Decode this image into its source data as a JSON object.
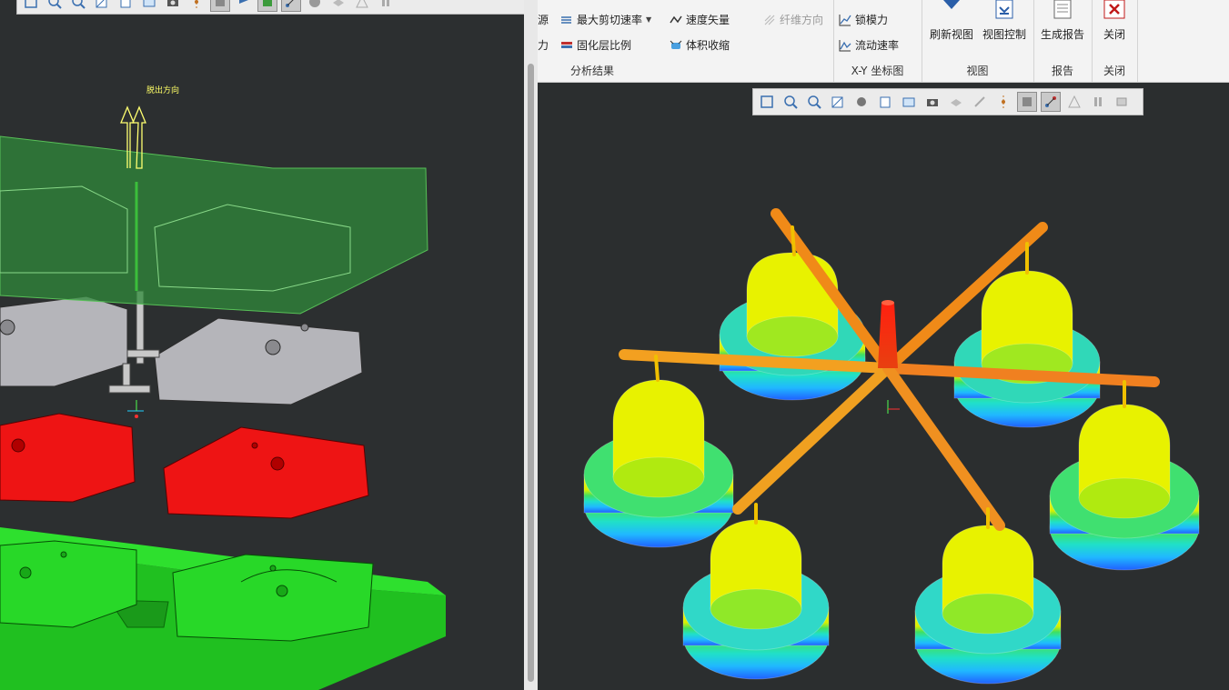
{
  "left_view": {
    "pull_direction_label": "脱出方向"
  },
  "ribbon": {
    "results_group": {
      "label": "分析结果",
      "partial_left_1": "源",
      "partial_left_2": "力",
      "max_shear_rate": "最大剪切速率",
      "velocity_vector": "速度矢量",
      "fiber_direction": "纤维方向",
      "solidified_layer_ratio": "固化层比例",
      "volumetric_shrinkage": "体积收缩"
    },
    "xy_group": {
      "label": "X-Y 坐标图",
      "clamp_force": "锁模力",
      "flow_rate": "流动速率"
    },
    "view_group": {
      "label": "视图",
      "refresh_view": "刷新视图",
      "view_control": "视图控制"
    },
    "report_group": {
      "label": "报告",
      "generate_report": "生成报告"
    },
    "close_group": {
      "label": "关闭",
      "close": "关闭"
    }
  },
  "colors": {
    "mold_top": "#2f8a3a",
    "core_gray": "#b4b4b8",
    "cavity_red": "#e21010",
    "base_green": "#22d322",
    "sprue_red": "#e8281a",
    "runner_orange": "#f08020",
    "part_yellow": "#f0f000",
    "part_cyan": "#20d8d8",
    "part_blue": "#2080ff"
  }
}
